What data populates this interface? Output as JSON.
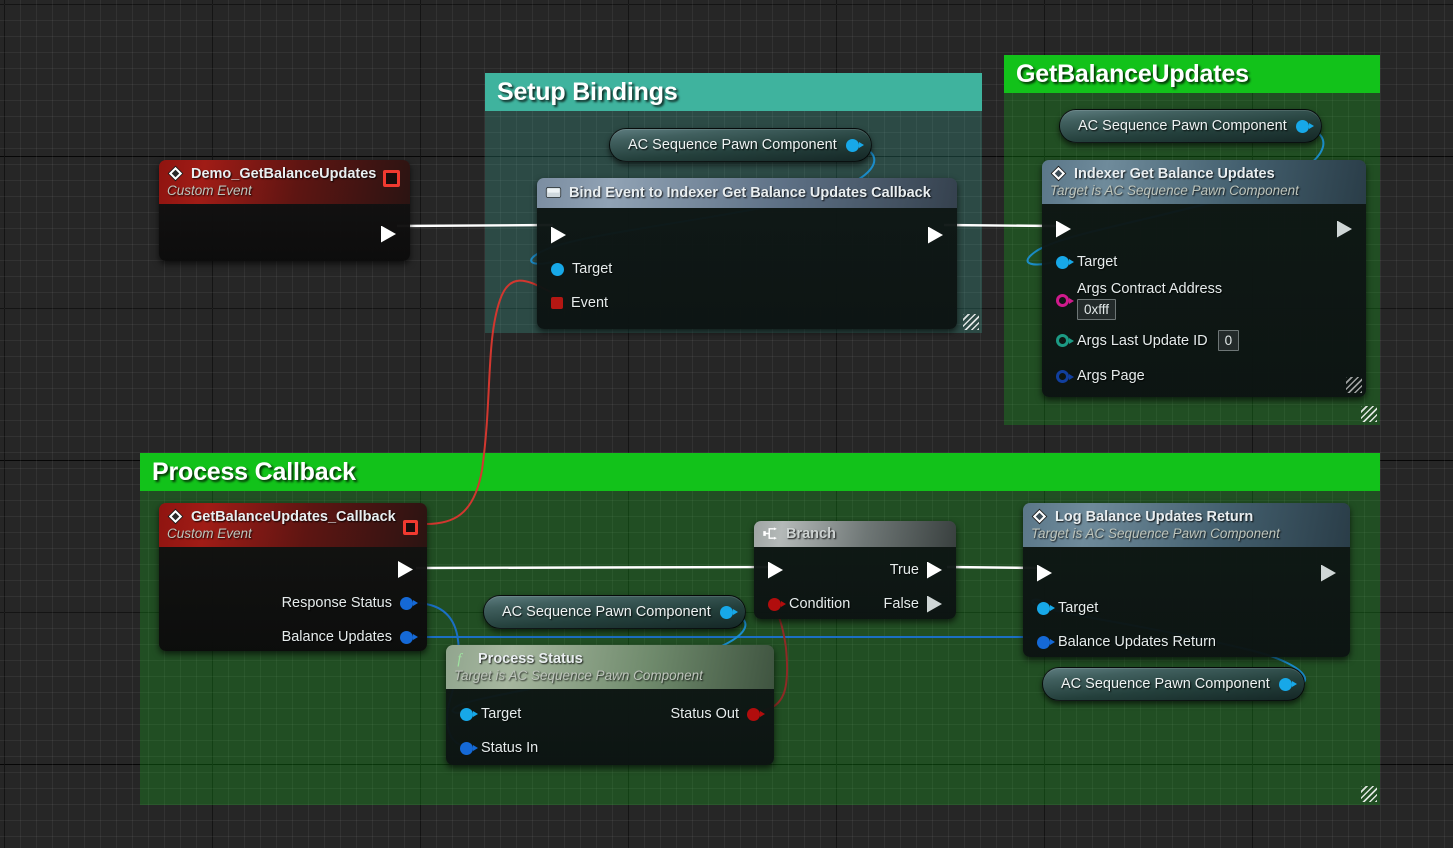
{
  "app": {
    "title": "Unreal Engine Blueprint Event Graph"
  },
  "comments": [
    {
      "label": "Setup Bindings",
      "color": "#3fb39e"
    },
    {
      "label": "GetBalanceUpdates",
      "color": "#12c21a"
    },
    {
      "label": "Process Callback",
      "color": "#12c21a"
    }
  ],
  "nodes": {
    "demo_event": {
      "title": "Demo_GetBalanceUpdates",
      "subtitle": "Custom Event",
      "icon": "event-diamond-icon",
      "delegate_pin": "delegate-output-pin"
    },
    "bind_event": {
      "title": "Bind Event to Indexer Get Balance Updates Callback",
      "icon": "bind-event-icon",
      "pins": [
        {
          "label": "Target",
          "type": "object"
        },
        {
          "label": "Event",
          "type": "delegate"
        }
      ]
    },
    "indexer_get": {
      "title": "Indexer Get Balance Updates",
      "subtitle": "Target is AC Sequence Pawn Component",
      "icon": "event-diamond-icon",
      "pins": [
        {
          "label": "Target",
          "type": "object",
          "value": null
        },
        {
          "label": "Args Contract Address",
          "type": "struct",
          "value": "0xfff"
        },
        {
          "label": "Args Last Update ID",
          "type": "int",
          "value": "0"
        },
        {
          "label": "Args Page",
          "type": "struct",
          "value": null
        }
      ]
    },
    "callback_event": {
      "title": "GetBalanceUpdates_Callback",
      "subtitle": "Custom Event",
      "icon": "event-diamond-icon",
      "delegate_pin": "delegate-output-pin",
      "outputs": [
        {
          "label": "Response Status",
          "type": "object"
        },
        {
          "label": "Balance Updates",
          "type": "object"
        }
      ]
    },
    "process_status": {
      "title": "Process Status",
      "subtitle": "Target is AC Sequence Pawn Component",
      "icon": "pure-function-icon",
      "inputs": [
        {
          "label": "Target",
          "type": "object"
        },
        {
          "label": "Status In",
          "type": "object"
        }
      ],
      "outputs": [
        {
          "label": "Status Out",
          "type": "bool"
        }
      ]
    },
    "branch": {
      "title": "Branch",
      "icon": "branch-icon",
      "inputs": [
        {
          "label": "Condition",
          "type": "bool"
        }
      ],
      "outputs": [
        {
          "label": "True"
        },
        {
          "label": "False"
        }
      ]
    },
    "log_balance": {
      "title": "Log Balance Updates Return",
      "subtitle": "Target is AC Sequence Pawn Component",
      "icon": "event-diamond-icon",
      "pins": [
        {
          "label": "Target",
          "type": "object"
        },
        {
          "label": "Balance Updates Return",
          "type": "object"
        }
      ]
    }
  },
  "variable_getters": [
    {
      "label": "AC Sequence Pawn Component"
    },
    {
      "label": "AC Sequence Pawn Component"
    },
    {
      "label": "AC Sequence Pawn Component"
    },
    {
      "label": "AC Sequence Pawn Component"
    }
  ],
  "pin_colors": {
    "exec": "#ffffff",
    "object": "#17a8e8",
    "object_dark": "#1569d6",
    "delegate": "#b31713",
    "bool": "#b10d0d",
    "struct_magenta": "#cf1a8c",
    "int_teal": "#1c9a84",
    "struct_navy": "#113f9e"
  }
}
